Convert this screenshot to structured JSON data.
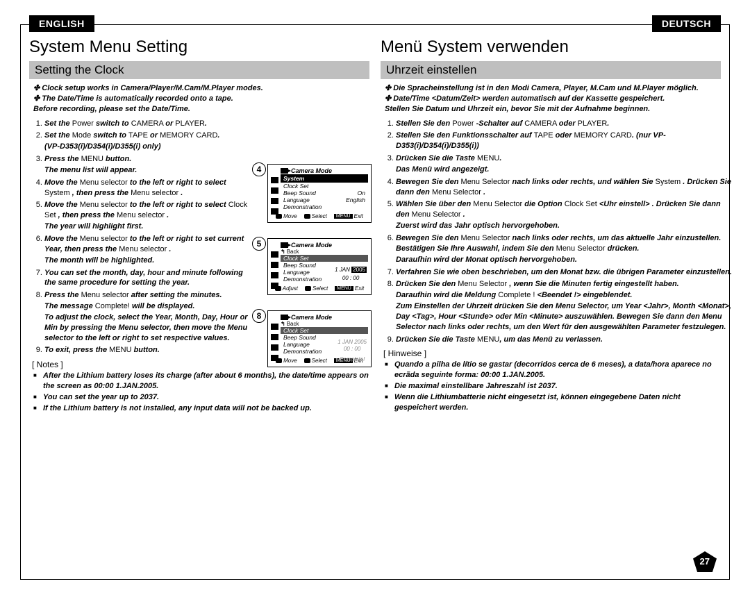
{
  "lang": {
    "left": "ENGLISH",
    "right": "DEUTSCH"
  },
  "page_number": "27",
  "left": {
    "title": "System Menu Setting",
    "subhead": "Setting the Clock",
    "intro_lines": [
      "Clock setup works in Camera/Player/M.Cam/M.Player modes.",
      "The Date/Time is automatically recorded onto a tape.",
      "Before recording, please set the Date/Time."
    ],
    "steps_html": [
      "<span class='bi'>Set the </span><span class='n'>Power </span><span class='bi'>switch to </span><span class='n'>CAMERA </span><span class='bi'>or </span><span class='n'>PLAYER</span><span class='bi'>.</span>",
      "<span class='bi'>Set the </span><span class='n'>Mode </span><span class='bi'>switch to </span><span class='n'>TAPE </span><span class='bi'>or </span><span class='n'>MEMORY CARD</span><span class='bi'>.</span><span class='sub'>(VP-D353(i)/D354(i)/D355(i) only)</span>",
      "<span class='bi'>Press the </span><span class='n'>MENU </span><span class='bi'>button.</span><span class='sub'>The menu list will appear.</span>",
      "<span class='bi'>Move the </span><span class='n'>Menu selector </span><span class='bi'>to the left or right to select</span> <span class='n'>System </span><span class='bi'>, then press the </span><span class='n'>Menu selector </span><span class='bi'>.</span>",
      "<span class='bi'>Move the </span><span class='n'>Menu selector </span><span class='bi'>to the left or right to select</span> <span class='n'>Clock Set </span><span class='bi'>, then press the </span><span class='n'>Menu selector </span><span class='bi'>.</span><span class='sub'>The year will highlight first.</span>",
      "<span class='bi'>Move the </span><span class='n'>Menu selector </span><span class='bi'>to the left or right to set current Year, then press the </span><span class='n'>Menu selector </span><span class='bi'>.</span><span class='sub'>The month will be highlighted.</span>",
      "<span class='bi'>You can set the month, day, hour and minute following the same procedure for setting the year.</span>",
      "<span class='bi'>Press the </span><span class='n'>Menu selector </span><span class='bi'>after setting the minutes.</span><span class='sub'><span class='bi'>The message </span><span class='n'>Complete! </span><span class='bi'>will be displayed.</span></span><span class='sub'>To adjust the clock, select the Year, Month, Day, Hour or Min by pressing the Menu selector, then move the Menu selector to the left or right to set respective values.</span>",
      "<span class='bi'>To exit, press the </span><span class='n'>MENU </span><span class='bi'>button.</span>"
    ],
    "notes_head": "[ Notes ]",
    "notes": [
      "After the Lithium battery loses its charge (after about 6 months), the date/time appears on the screen as 00:00 1.JAN.2005.",
      "You can set the year up to 2037.",
      "If the Lithium battery is not installed, any input data will not be backed up."
    ]
  },
  "right": {
    "title": "Menü System verwenden",
    "subhead": "Uhrzeit einstellen",
    "intro_lines": [
      "Die Spracheinstellung ist in den Modi Camera, Player, M.Cam und M.Player möglich.",
      "Date/Time <Datum/Zeit> werden automatisch auf der Kassette gespeichert.",
      "Stellen Sie Datum und Uhrzeit ein, bevor Sie mit der Aufnahme beginnen."
    ],
    "steps_html": [
      "<span class='bi'>Stellen Sie den </span><span class='n'>Power </span><span class='bi'>-Schalter auf </span><span class='n'>CAMERA </span><span class='bi'>oder </span><span class='n'>PLAYER</span><span class='bi'>.</span>",
      "<span class='bi'>Stellen Sie den Funktionsschalter auf </span><span class='n'>TAPE </span><span class='bi'>oder</span> <span class='n'>MEMORY CARD</span><span class='bi'>. (nur VP-D353(i)/D354(i)/D355(i))</span>",
      "<span class='bi'>Drücken Sie die Taste </span><span class='n'>MENU</span><span class='bi'>.</span><span class='sub'>Das Menü wird angezeigt.</span>",
      "<span class='bi'>Bewegen Sie den </span><span class='n'>Menu Selector </span><span class='bi'>nach links oder rechts, und wählen Sie </span><span class='n'>System </span><span class='bi'>. Drücken Sie dann den </span><span class='n'>Menu Selector </span><span class='bi'>.</span>",
      "<span class='bi'>Wählen Sie über den </span><span class='n'>Menu Selector </span><span class='bi'>die Option </span><span class='n'>Clock Set </span><span class='bi'>&lt;Uhr einstell&gt; . Drücken Sie dann den </span><span class='n'>Menu Selector </span><span class='bi'>.</span><span class='sub'>Zuerst wird das Jahr optisch hervorgehoben.</span>",
      "<span class='bi'>Bewegen Sie den </span><span class='n'>Menu Selector </span><span class='bi'>nach links oder rechts, um das aktuelle Jahr einzustellen. Bestätigen Sie Ihre Auswahl, indem Sie den </span><span class='n'>Menu Selector </span><span class='bi'>drücken.</span><span class='sub'>Daraufhin wird der Monat optisch hervorgehoben.</span>",
      "<span class='bi'>Verfahren Sie wie oben beschrieben, um den Monat bzw. die übrigen Parameter einzustellen.</span>",
      "<span class='bi'>Drücken Sie den </span><span class='n'>Menu Selector </span><span class='bi'>, wenn Sie die Minuten fertig eingestellt haben.</span><span class='sub'><span class='bi'>Daraufhin wird die Meldung </span><span class='n'>Complete ! </span><span class='bi'>&lt;Beendet !&gt; eingeblendet.</span></span><span class='sub'>Zum Einstellen der Uhrzeit drücken Sie den Menu Selector, um Year &lt;Jahr&gt;, Month &lt;Monat&gt;, Day &lt;Tag&gt;, Hour &lt;Stunde&gt; oder Min &lt;Minute&gt; auszuwählen. Bewegen Sie dann den Menu Selector nach links oder rechts, um den Wert für den ausgewählten Parameter festzulegen.</span>",
      "<span class='bi'>Drücken Sie die Taste </span><span class='n'>MENU</span><span class='bi'>, um das Menü zu verlassen.</span>"
    ],
    "notes_head": "[ Hinweise ]",
    "notes": [
      "Quando a pilha de lítio se gastar (decorridos cerca de 6 meses), a data/hora aparece no ecrãda seguinte forma: 00:00 1.JAN.2005.",
      "Die maximal einstellbare Jahreszahl ist 2037.",
      "Wenn die Lithiumbatterie nicht eingesetzt ist, können eingegebene Daten nicht gespeichert werden."
    ]
  },
  "figs": {
    "f4": {
      "num": "4",
      "title": "Camera Mode",
      "sys": "System",
      "rows": [
        [
          "Clock Set",
          ""
        ],
        [
          "Beep Sound",
          "On"
        ],
        [
          "Language",
          "English"
        ],
        [
          "Demonstration",
          ""
        ]
      ],
      "footer": [
        "Move",
        "Select",
        "Exit"
      ]
    },
    "f5": {
      "num": "5",
      "title": "Camera Mode",
      "back": "Back",
      "rows": [
        [
          "Clock Set",
          ""
        ],
        [
          "Beep Sound",
          ""
        ],
        [
          "Language",
          ""
        ],
        [
          "Demonstration",
          ""
        ]
      ],
      "date": {
        "d": "1",
        "m": "JAN",
        "y": "2005",
        "t": "00 : 00"
      },
      "footer": [
        "Adjust",
        "Select",
        "Exit"
      ]
    },
    "f8": {
      "num": "8",
      "title": "Camera Mode",
      "back": "Back",
      "rows": [
        [
          "Clock Set",
          ""
        ],
        [
          "Beep Sound",
          ""
        ],
        [
          "Language",
          ""
        ],
        [
          "Demonstration",
          ""
        ]
      ],
      "date2": {
        "d": "1   JAN   2005",
        "t": "00 : 00",
        "c": "Complete!"
      },
      "footer": [
        "Move",
        "Select",
        "Exit"
      ]
    }
  }
}
